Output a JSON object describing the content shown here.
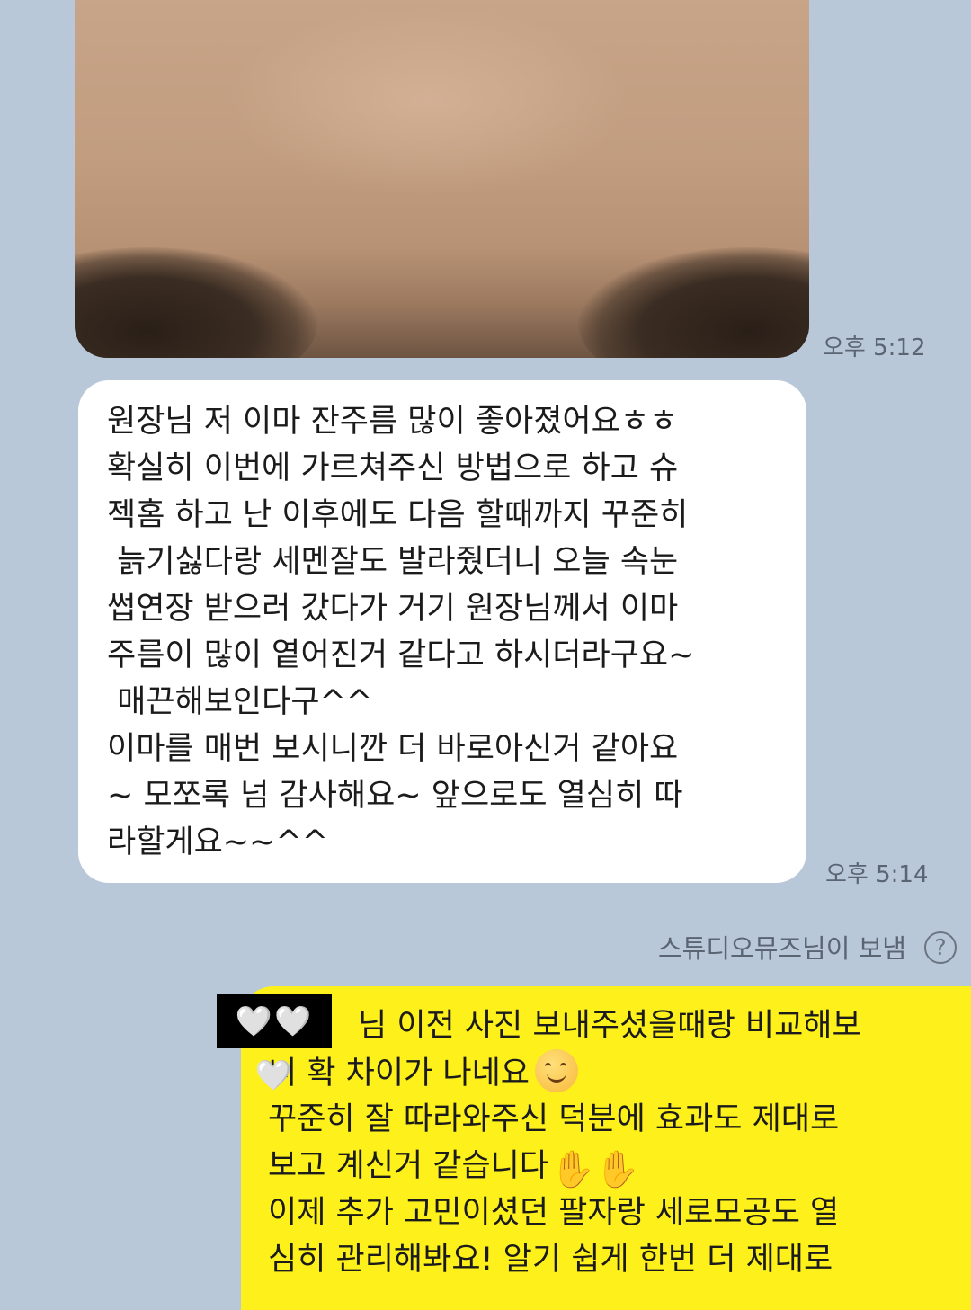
{
  "messages": {
    "photo": {
      "time": "오후 5:12"
    },
    "incoming": {
      "lines": [
        "원장님 저 이마 잔주름 많이 좋아졌어요ㅎㅎ",
        "확실히 이번에 가르쳐주신 방법으로 하고 슈",
        "젝홈 하고 난 이후에도 다음 할때까지 꾸준히",
        " 늙기싫다랑 세멘잘도 발라줬더니 오늘 속눈",
        "썹연장 받으러 갔다가 거기 원장님께서 이마",
        "주름이 많이 옅어진거 같다고 하시더라구요~",
        " 매끈해보인다구^^",
        "이마를 매번 보시니깐 더 바로아신거 같아요",
        "~ 모쪼록 넘 감사해요~ 앞으로도 열심히 따",
        "라할게요~~^^"
      ],
      "time": "오후 5:14"
    },
    "sender_note": "스튜디오뮤즈님이 보냄",
    "help_glyph": "?",
    "outgoing": {
      "masked_name": "🤍🤍🤍",
      "lines": [
        "님 이전 사진 보내주셨을때랑 비교해보",
        "니 확 차이가 나네요",
        "꾸준히 잘 따라와주신 덕분에 효과도 제대로",
        "보고 계신거 같습니다",
        "이제 추가 고민이셨던 팔자랑 세로모공도 열",
        "심히 관리해봐요! 알기 쉽게 한번 더 제대로"
      ],
      "emoji_icons": [
        "smiling-face-icon",
        "raising-hands-icon"
      ]
    }
  }
}
